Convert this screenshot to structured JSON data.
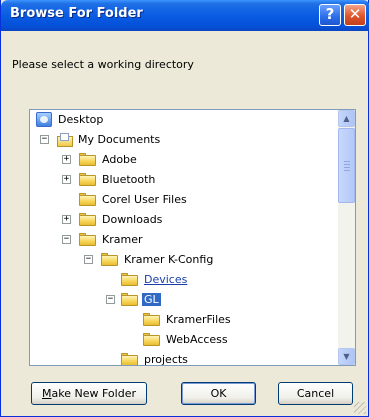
{
  "window": {
    "title": "Browse For Folder",
    "help_label": "?",
    "close_label": "✕"
  },
  "prompt": "Please select a working directory",
  "tree": {
    "items": [
      {
        "label": "Desktop"
      },
      {
        "label": "My Documents",
        "expander": "−"
      },
      {
        "label": "Adobe",
        "expander": "+"
      },
      {
        "label": "Bluetooth",
        "expander": "+"
      },
      {
        "label": "Corel User Files"
      },
      {
        "label": "Downloads",
        "expander": "+"
      },
      {
        "label": "Kramer",
        "expander": "−"
      },
      {
        "label": "Kramer K-Config",
        "expander": "−"
      },
      {
        "label": "Devices"
      },
      {
        "label": "GL",
        "expander": "−"
      },
      {
        "label": "KramerFiles"
      },
      {
        "label": "WebAccess"
      },
      {
        "label": "projects"
      }
    ]
  },
  "buttons": {
    "make_new_folder_first": "M",
    "make_new_folder_rest": "ake New Folder",
    "ok": "OK",
    "cancel": "Cancel"
  },
  "scrollbar": {
    "up_arrow": "▲",
    "down_arrow": "▼"
  },
  "colors": {
    "titlebar": "#0a5ce3",
    "selection": "#316ac5",
    "link": "#1a3fa8"
  }
}
